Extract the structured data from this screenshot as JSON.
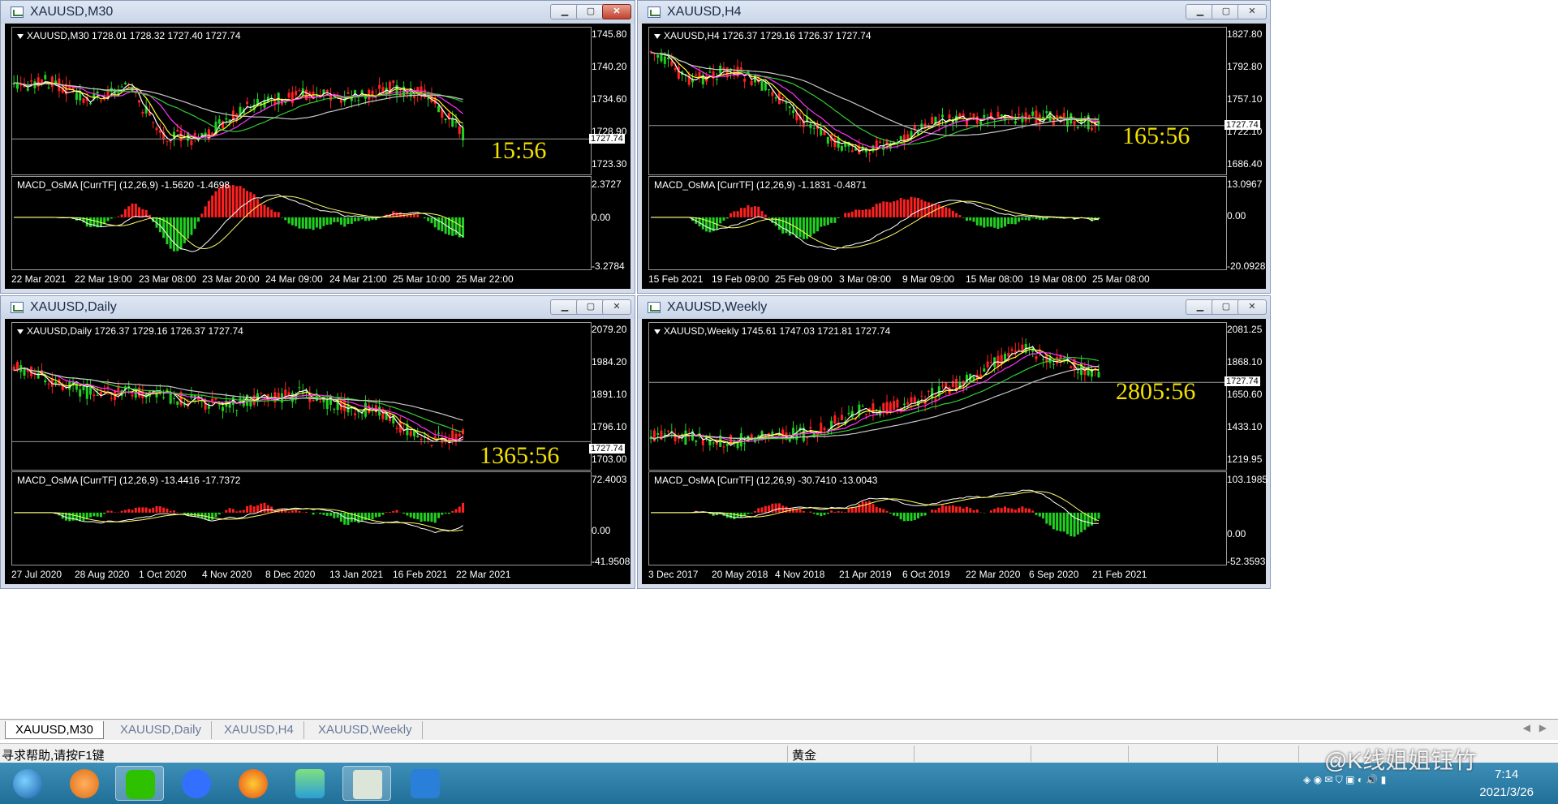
{
  "windows": [
    {
      "id": "m30",
      "title": "XAUUSD,M30",
      "active": true,
      "price_label": "XAUUSD,M30  1728.01 1728.32 1727.40 1727.74",
      "price_axis": [
        "1745.80",
        "1740.20",
        "1734.60",
        "1728.90",
        "1723.30"
      ],
      "current_price": "1727.74",
      "countdown": "15:56",
      "indicator_label": "MACD_OsMA [CurrTF] (12,26,9) -1.5620 -1.4698",
      "indicator_axis": [
        "2.3727",
        "0.00",
        "-3.2784"
      ],
      "time_axis": [
        "22 Mar 2021",
        "22 Mar 19:00",
        "23 Mar 08:00",
        "23 Mar 20:00",
        "24 Mar 09:00",
        "24 Mar 21:00",
        "25 Mar 10:00",
        "25 Mar 22:00"
      ]
    },
    {
      "id": "h4",
      "title": "XAUUSD,H4",
      "active": false,
      "price_label": "XAUUSD,H4  1726.37 1729.16 1726.37 1727.74",
      "price_axis": [
        "1827.80",
        "1792.80",
        "1757.10",
        "1722.10",
        "1686.40"
      ],
      "current_price": "1727.74",
      "countdown": "165:56",
      "indicator_label": "MACD_OsMA [CurrTF] (12,26,9) -1.1831 -0.4871",
      "indicator_axis": [
        "13.0967",
        "0.00",
        "-20.0928"
      ],
      "time_axis": [
        "15 Feb 2021",
        "19 Feb 09:00",
        "25 Feb 09:00",
        "3 Mar 09:00",
        "9 Mar 09:00",
        "15 Mar 08:00",
        "19 Mar 08:00",
        "25 Mar 08:00"
      ]
    },
    {
      "id": "daily",
      "title": "XAUUSD,Daily",
      "active": false,
      "price_label": "XAUUSD,Daily  1726.37 1729.16 1726.37 1727.74",
      "price_axis": [
        "2079.20",
        "1984.20",
        "1891.10",
        "1796.10",
        "1703.00"
      ],
      "current_price": "1727.74",
      "countdown": "1365:56",
      "indicator_label": "MACD_OsMA [CurrTF] (12,26,9) -13.4416 -17.7372",
      "indicator_axis": [
        "72.4003",
        "0.00",
        "-41.9508"
      ],
      "time_axis": [
        "27 Jul 2020",
        "28 Aug 2020",
        "1 Oct 2020",
        "4 Nov 2020",
        "8 Dec 2020",
        "13 Jan 2021",
        "16 Feb 2021",
        "22 Mar 2021"
      ]
    },
    {
      "id": "weekly",
      "title": "XAUUSD,Weekly",
      "active": false,
      "price_label": "XAUUSD,Weekly  1745.61 1747.03 1721.81 1727.74",
      "price_axis": [
        "2081.25",
        "1868.10",
        "1650.60",
        "1433.10",
        "1219.95"
      ],
      "current_price": "1727.74",
      "countdown": "2805:56",
      "indicator_label": "MACD_OsMA [CurrTF] (12,26,9) -30.7410 -13.0043",
      "indicator_axis": [
        "103.1985",
        "0.00",
        "-52.3593"
      ],
      "time_axis": [
        "3 Dec 2017",
        "20 May 2018",
        "4 Nov 2018",
        "21 Apr 2019",
        "6 Oct 2019",
        "22 Mar 2020",
        "6 Sep 2020",
        "21 Feb 2021"
      ]
    }
  ],
  "tabs": [
    {
      "label": "XAUUSD,M30",
      "active": true
    },
    {
      "label": "XAUUSD,Daily",
      "active": false
    },
    {
      "label": "XAUUSD,H4",
      "active": false
    },
    {
      "label": "XAUUSD,Weekly",
      "active": false
    }
  ],
  "status": {
    "help_text": "寻求帮助,请按F1键",
    "profile": "黄金"
  },
  "taskbar": {
    "apps": [
      "start-orb-icon",
      "app-orange-icon",
      "wechat-icon",
      "feishu-icon",
      "firefox-icon",
      "media-player-icon",
      "trading-app-icon",
      "security-shield-icon"
    ],
    "time": "7:14",
    "date": "2021/3/26",
    "watermark": "@K线姐姐钰竹"
  },
  "colors": {
    "bull": "#21d121",
    "bear": "#ff2020",
    "ma_fast": "#ffffff",
    "ma_yellow": "#ffff33",
    "ma_magenta": "#ff33ff",
    "ma_green": "#33cc33",
    "ma_gray": "#c8c8c8",
    "countdown": "#f2e100"
  }
}
